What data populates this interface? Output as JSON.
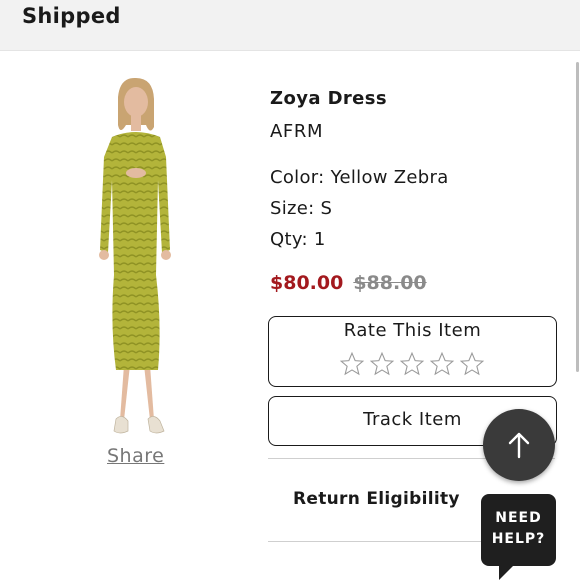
{
  "header": {
    "title": "Shipped"
  },
  "product": {
    "name": "Zoya Dress",
    "brand": "AFRM",
    "color": "Color: Yellow Zebra",
    "size": "Size: S",
    "qty": "Qty: 1",
    "sale_price": "$80.00",
    "original_price": "$88.00"
  },
  "share": {
    "label": "Share"
  },
  "rating": {
    "title": "Rate This Item",
    "max_stars": 5,
    "current": 0
  },
  "track": {
    "label": "Track Item"
  },
  "return": {
    "label": "Return Eligibility"
  },
  "help": {
    "line1": "NEED",
    "line2": "HELP?"
  },
  "icons": {
    "scroll_top": "arrow-up-icon",
    "expand": "plus-icon",
    "star": "star-outline-icon"
  },
  "colors": {
    "sale": "#a3191e",
    "dress": "#b7b93a",
    "fab": "#3a3a3a",
    "help_bg": "#1f1f1f"
  }
}
